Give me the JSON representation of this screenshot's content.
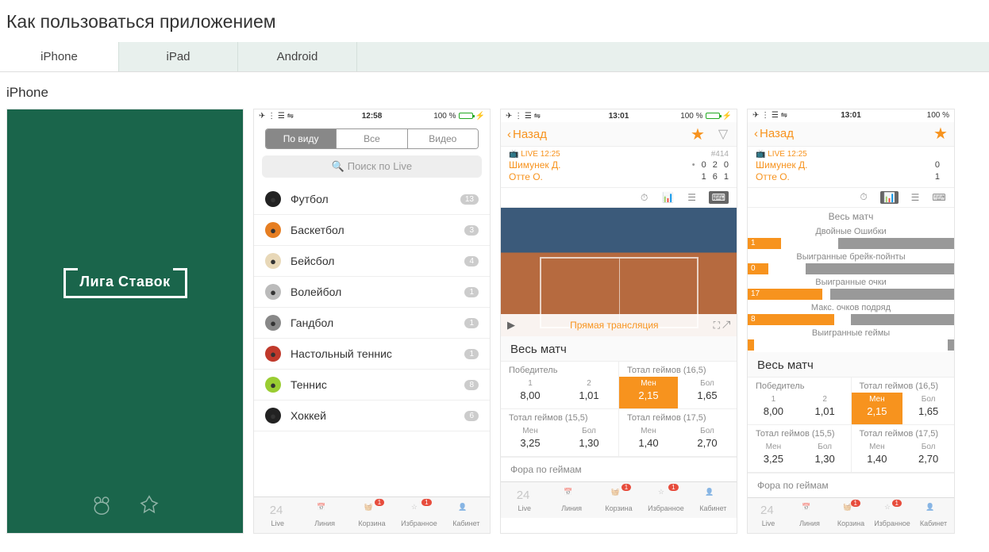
{
  "page_title": "Как пользоваться приложением",
  "tabs": [
    "iPhone",
    "iPad",
    "Android"
  ],
  "active_tab": "iPhone",
  "subhead": "iPhone",
  "splash_logo": "Лига Ставок",
  "status": {
    "time1": "12:58",
    "time2": "13:01",
    "time3": "13:01",
    "batt": "100 %"
  },
  "seg": {
    "a": "По виду",
    "b": "Все",
    "c": "Видео"
  },
  "search_placeholder": "Поиск по Live",
  "sports": [
    {
      "name": "Футбол",
      "count": "13",
      "color": "#222"
    },
    {
      "name": "Баскетбол",
      "count": "3",
      "color": "#e67e22"
    },
    {
      "name": "Бейсбол",
      "count": "4",
      "color": "#e8d8b8"
    },
    {
      "name": "Волейбол",
      "count": "1",
      "color": "#bbb"
    },
    {
      "name": "Гандбол",
      "count": "1",
      "color": "#888"
    },
    {
      "name": "Настольный теннис",
      "count": "1",
      "color": "#c0392b"
    },
    {
      "name": "Теннис",
      "count": "8",
      "color": "#9acd32"
    },
    {
      "name": "Хоккей",
      "count": "6",
      "color": "#222"
    }
  ],
  "tabbar": [
    {
      "label": "Live",
      "badge": ""
    },
    {
      "label": "Линия",
      "badge": ""
    },
    {
      "label": "Корзина",
      "badge": "1"
    },
    {
      "label": "Избранное",
      "badge": "1"
    },
    {
      "label": "Кабинет",
      "badge": ""
    }
  ],
  "match": {
    "back": "Назад",
    "live": "LIVE 12:25",
    "id": "#414",
    "p1": "Шимунек Д.",
    "p2": "Отте О.",
    "score1": [
      "0",
      "2",
      "0"
    ],
    "score2": [
      "1",
      "6",
      "1"
    ],
    "video_label": "Прямая трансляция",
    "sec_title": "Весь матч",
    "winner": "Победитель",
    "total165": "Тотал геймов (16,5)",
    "total155": "Тотал геймов (15,5)",
    "total175": "Тотал геймов (17,5)",
    "fora": "Фора по геймам",
    "labels": {
      "one": "1",
      "two": "2",
      "men": "Мен",
      "bol": "Бол"
    },
    "odds": {
      "w1": "8,00",
      "w2": "1,01",
      "t165m": "2,15",
      "t165b": "1,65",
      "t155m": "3,25",
      "t155b": "1,30",
      "t175m": "1,40",
      "t175b": "2,70"
    }
  },
  "stats": {
    "title": "Весь матч",
    "rows": [
      {
        "label": "Двойные Ошибки",
        "l": "1",
        "lw": 16,
        "r": "",
        "rw": 56
      },
      {
        "label": "Выигранные брейк-пойнты",
        "l": "0",
        "lw": 10,
        "r": "",
        "rw": 72
      },
      {
        "label": "Выигранные очки",
        "l": "17",
        "lw": 36,
        "r": "",
        "rw": 60
      },
      {
        "label": "Макс. очков подряд",
        "l": "8",
        "lw": 42,
        "r": "",
        "rw": 50
      },
      {
        "label": "Выигранные геймы",
        "l": "",
        "lw": 0,
        "r": "",
        "rw": 0
      }
    ]
  }
}
